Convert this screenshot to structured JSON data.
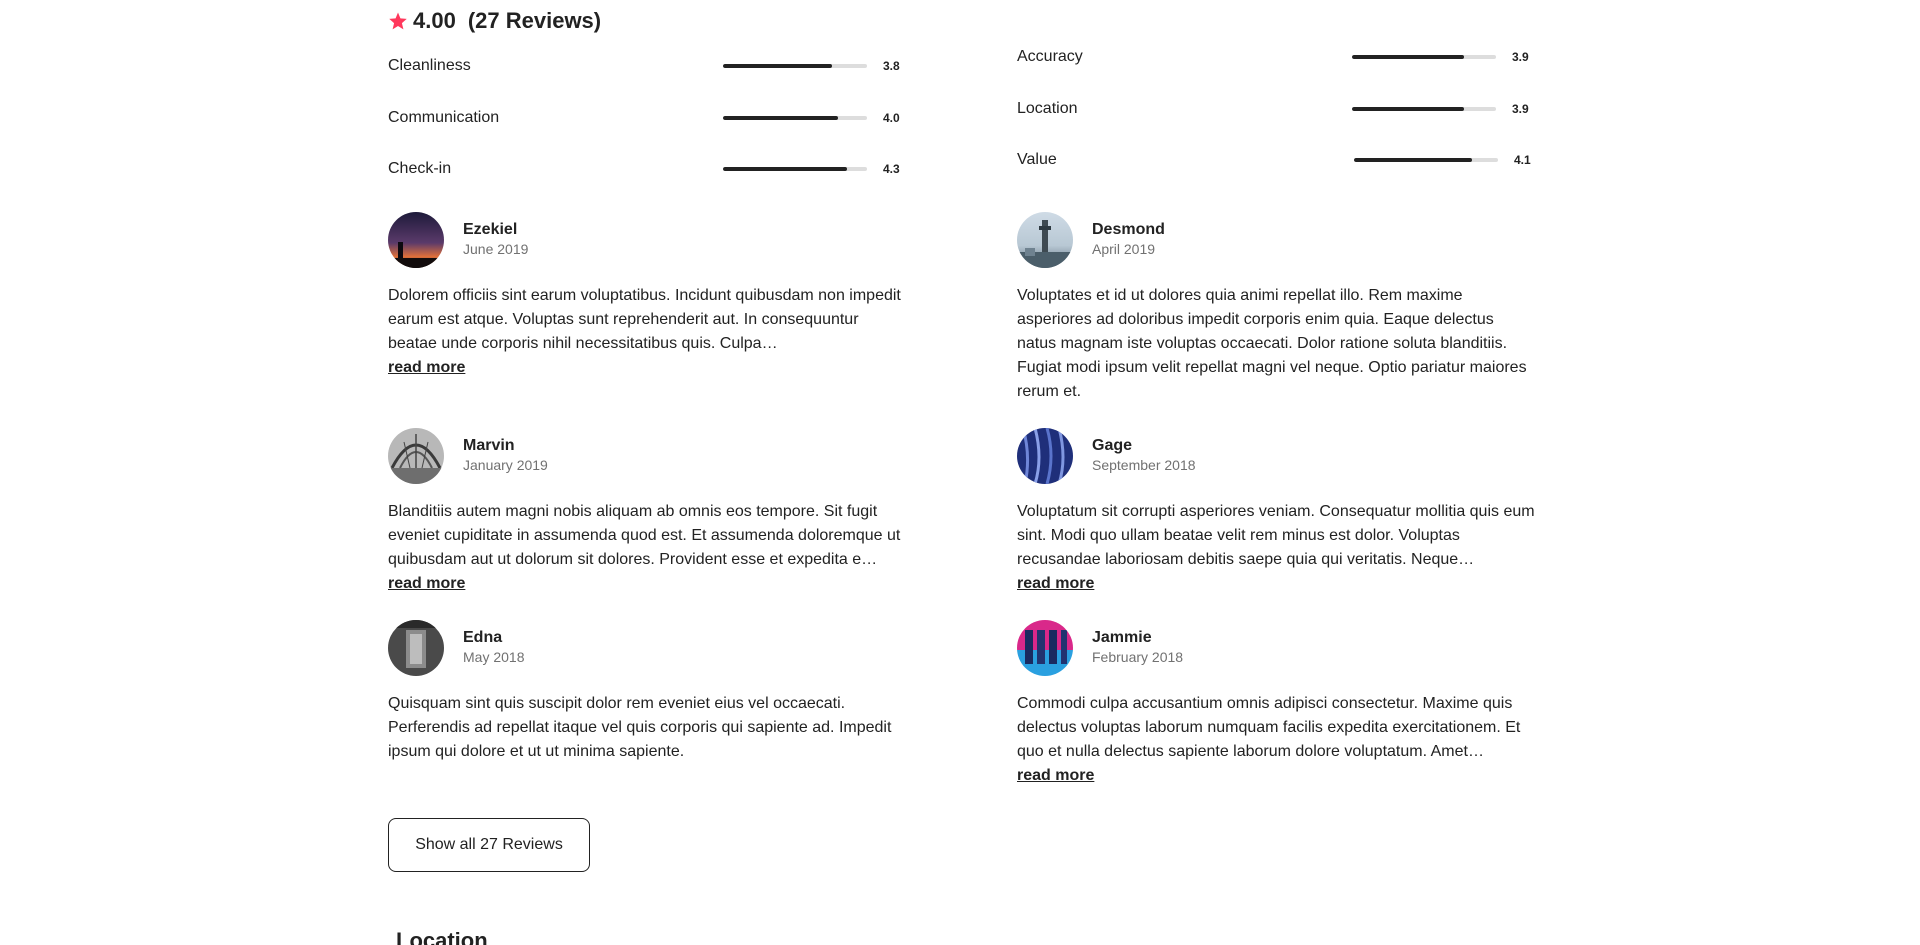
{
  "summary": {
    "rating": "4.00",
    "reviews_label": "(27 Reviews)",
    "star_color": "#FF385C"
  },
  "categories": [
    {
      "label": "Cleanliness",
      "score": "3.8",
      "value": 3.8
    },
    {
      "label": "Accuracy",
      "score": "3.9",
      "value": 3.9
    },
    {
      "label": "Communication",
      "score": "4.0",
      "value": 4.0
    },
    {
      "label": "Location",
      "score": "3.9",
      "value": 3.9
    },
    {
      "label": "Check-in",
      "score": "4.3",
      "value": 4.3
    },
    {
      "label": "Value",
      "score": "4.1",
      "value": 4.1
    }
  ],
  "reviews": [
    {
      "name": "Ezekiel",
      "date": "June 2019",
      "text": "Dolorem officiis sint earum voluptatibus. Incidunt quibusdam non impedit earum est atque. Voluptas sunt reprehenderit aut. In consequuntur beatae unde corporis nihil necessitatibus quis. Culpa…",
      "read_more": "read more"
    },
    {
      "name": "Desmond",
      "date": "April 2019",
      "text": "Voluptates et id ut dolores quia animi repellat illo. Rem maxime asperiores ad doloribus impedit corporis enim quia. Eaque delectus natus magnam iste voluptas occaecati. Dolor ratione soluta blanditiis. Fugiat modi ipsum velit repellat magni vel neque. Optio pariatur maiores rerum et.",
      "read_more": ""
    },
    {
      "name": "Marvin",
      "date": "January 2019",
      "text": "Blanditiis autem magni nobis aliquam ab omnis eos tempore. Sit fugit eveniet cupiditate in assumenda quod est. Et assumenda doloremque ut quibusdam aut ut dolorum sit dolores. Provident esse et expedita e…",
      "read_more": "read more"
    },
    {
      "name": "Gage",
      "date": "September 2018",
      "text": "Voluptatum sit corrupti asperiores veniam. Consequatur mollitia quis eum sint. Modi quo ullam beatae velit rem minus est dolor. Voluptas recusandae laboriosam debitis saepe quia qui veritatis. Neque…",
      "read_more": "read more"
    },
    {
      "name": "Edna",
      "date": "May 2018",
      "text": "Quisquam sint quis suscipit dolor rem eveniet eius vel occaecati. Perferendis ad repellat itaque vel quis corporis qui sapiente ad. Impedit ipsum qui dolore et ut ut minima sapiente.",
      "read_more": ""
    },
    {
      "name": "Jammie",
      "date": "February 2018",
      "text": "Commodi culpa accusantium omnis adipisci consectetur. Maxime quis delectus voluptas laborum numquam facilis expedita exercitationem. Et quo et nulla delectus sapiente laborum dolore voluptatum. Amet…",
      "read_more": "read more"
    }
  ],
  "show_all_label": "Show all 27 Reviews",
  "location_heading": "Location"
}
